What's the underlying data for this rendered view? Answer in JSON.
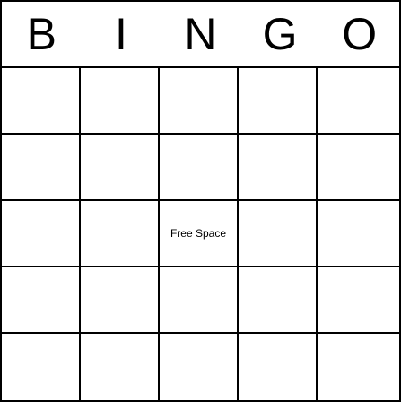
{
  "header": {
    "letters": [
      "B",
      "I",
      "N",
      "G",
      "O"
    ]
  },
  "grid": {
    "rows": [
      [
        "",
        "",
        "",
        "",
        ""
      ],
      [
        "",
        "",
        "",
        "",
        ""
      ],
      [
        "",
        "",
        "Free Space",
        "",
        ""
      ],
      [
        "",
        "",
        "",
        "",
        ""
      ],
      [
        "",
        "",
        "",
        "",
        ""
      ]
    ]
  },
  "colors": {
    "line": "#000000",
    "background": "#ffffff"
  }
}
